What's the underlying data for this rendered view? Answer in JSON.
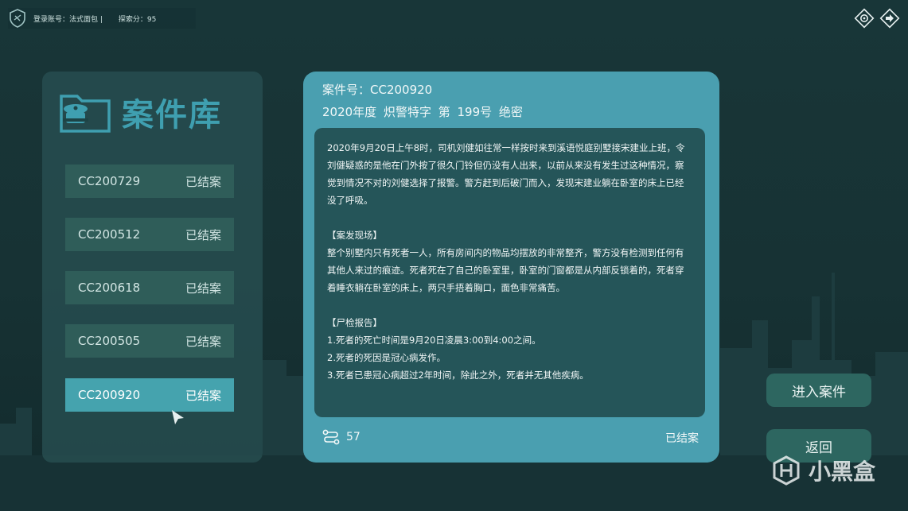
{
  "topbar": {
    "account_label": "登录账号：法式面包 |",
    "score_label": "探索分：95"
  },
  "top_icons": [
    "settings-icon",
    "exit-icon"
  ],
  "library": {
    "title": "案件库",
    "cases": [
      {
        "id": "CC200729",
        "status": "已结案"
      },
      {
        "id": "CC200512",
        "status": "已结案"
      },
      {
        "id": "CC200618",
        "status": "已结案"
      },
      {
        "id": "CC200505",
        "status": "已结案"
      },
      {
        "id": "CC200920",
        "status": "已结案",
        "selected": true
      }
    ]
  },
  "detail": {
    "case_id_line": "案件号：CC200920",
    "subtitle": "2020年度  炽警特字  第 199号  绝密",
    "summary": "2020年9月20日上午8时，司机刘健如往常一样按时来到溪语悦庭别墅接宋建业上班，令刘健疑惑的是他在门外按了很久门铃但仍没有人出来，以前从来没有发生过这种情况，察觉到情况不对的刘健选择了报警。警方赶到后破门而入，发现宋建业躺在卧室的床上已经没了呼吸。",
    "scene_heading": "【案发现场】",
    "scene_text": "整个别墅内只有死者一人，所有房间内的物品均摆放的非常整齐，警方没有检测到任何有其他人来过的痕迹。死者死在了自己的卧室里，卧室的门窗都是从内部反锁着的，死者穿着睡衣躺在卧室的床上，两只手捂着胸口，面色非常痛苦。",
    "autopsy_heading": "【尸检报告】",
    "autopsy_items": [
      "1.死者的死亡时间是9月20日凌晨3:00到4:00之间。",
      "2.死者的死因是冠心病发作。",
      "3.死者已患冠心病超过2年时间，除此之外，死者并无其他疾病。"
    ],
    "count": "57",
    "status": "已结案"
  },
  "buttons": {
    "enter": "进入案件",
    "back": "返回"
  },
  "watermark": "小黑盒",
  "colors": {
    "background": "#183638",
    "panel": "#285052",
    "accent": "#45a3ae",
    "detail_panel": "#4a9fb0",
    "detail_body": "#255559",
    "button": "#2d6660"
  }
}
